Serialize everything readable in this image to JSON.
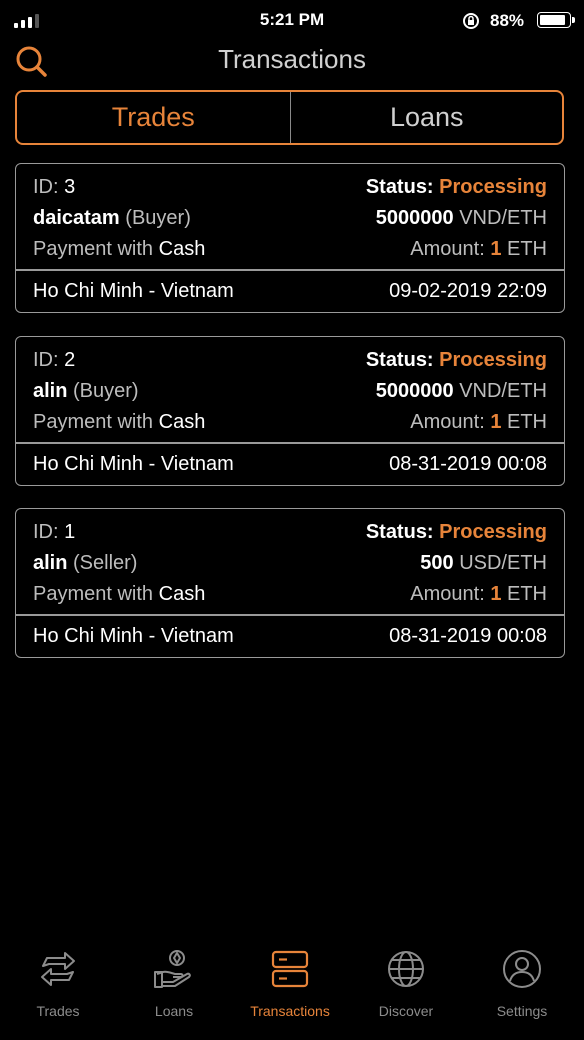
{
  "status_bar": {
    "time": "5:21 PM",
    "battery": "88%"
  },
  "header": {
    "title": "Transactions"
  },
  "segment": {
    "trades": "Trades",
    "loans": "Loans"
  },
  "transactions": [
    {
      "id_label": "ID:",
      "id": "3",
      "status_label": "Status:",
      "status": "Processing",
      "user": "daicatam",
      "role": "(Buyer)",
      "price": "5000000",
      "pair": "VND/ETH",
      "payment_label": "Payment with",
      "payment_method": "Cash",
      "amount_label": "Amount:",
      "amount": "1",
      "amount_unit": "ETH",
      "location": "Ho Chi Minh - Vietnam",
      "datetime": "09-02-2019 22:09"
    },
    {
      "id_label": "ID:",
      "id": "2",
      "status_label": "Status:",
      "status": "Processing",
      "user": "alin",
      "role": "(Buyer)",
      "price": "5000000",
      "pair": "VND/ETH",
      "payment_label": "Payment with",
      "payment_method": "Cash",
      "amount_label": "Amount:",
      "amount": "1",
      "amount_unit": "ETH",
      "location": "Ho Chi Minh - Vietnam",
      "datetime": "08-31-2019 00:08"
    },
    {
      "id_label": "ID:",
      "id": "1",
      "status_label": "Status:",
      "status": "Processing",
      "user": "alin",
      "role": "(Seller)",
      "price": "500",
      "pair": "USD/ETH",
      "payment_label": "Payment with",
      "payment_method": "Cash",
      "amount_label": "Amount:",
      "amount": "1",
      "amount_unit": "ETH",
      "location": "Ho Chi Minh - Vietnam",
      "datetime": "08-31-2019 00:08"
    }
  ],
  "tabbar": {
    "items": [
      {
        "label": "Trades",
        "icon": "exchange-icon"
      },
      {
        "label": "Loans",
        "icon": "hand-coin-icon"
      },
      {
        "label": "Transactions",
        "icon": "server-icon",
        "active": true
      },
      {
        "label": "Discover",
        "icon": "globe-icon"
      },
      {
        "label": "Settings",
        "icon": "user-icon"
      }
    ]
  },
  "colors": {
    "accent": "#e7843a",
    "background": "#000000",
    "border": "#9a9a9a",
    "muted_text": "#bdbdbd"
  }
}
